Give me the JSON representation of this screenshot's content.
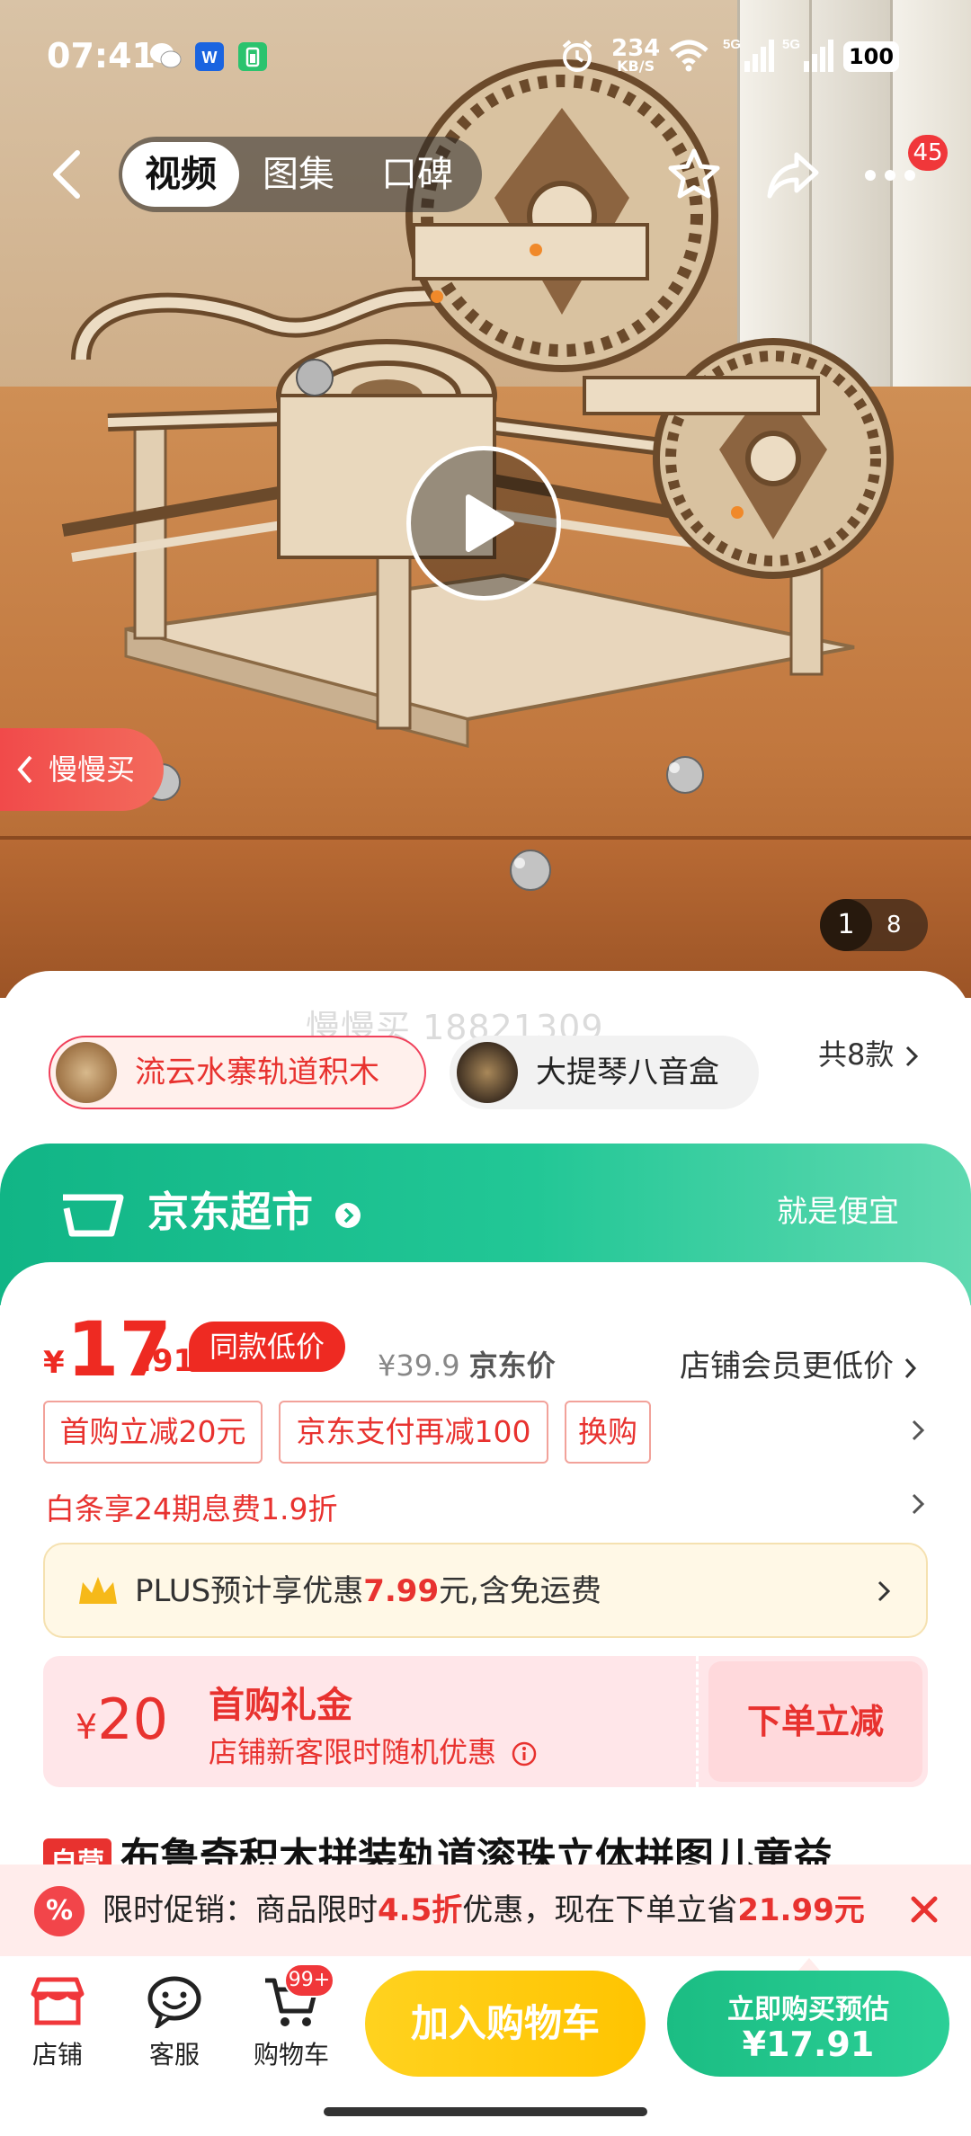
{
  "status_bar": {
    "time": "07:41",
    "net_speed_value": "234",
    "net_speed_unit": "KB/S",
    "signal1": "5G",
    "signal2": "5G",
    "battery": "100"
  },
  "nav": {
    "tabs": [
      {
        "label": "视频",
        "active": true
      },
      {
        "label": "图集",
        "active": false
      },
      {
        "label": "口碑",
        "active": false
      }
    ],
    "more_badge": "45",
    "icons": [
      "back-icon",
      "star-icon",
      "share-icon",
      "more-icon"
    ]
  },
  "gallery": {
    "slow_buy": "慢慢买",
    "page_current": "1",
    "page_total": "8",
    "play": "play-icon"
  },
  "watermark": "慢慢买 18821309",
  "variants": {
    "items": [
      {
        "label": "流云水寨轨道积木",
        "selected": true
      },
      {
        "label": "大提琴八音盒",
        "selected": false
      }
    ],
    "count": "共8款"
  },
  "jd_supermarket": {
    "logo": "京东超市",
    "slogan": "就是便宜"
  },
  "price": {
    "currency": "¥",
    "integer": "17",
    "decimal": ".91",
    "tag": "同款低价",
    "original": "¥39.9",
    "original_label": "京东价",
    "member": "店铺会员更低价"
  },
  "coupons": [
    "首购立减20元",
    "京东支付再减100",
    "换购"
  ],
  "baitiao": "白条享24期息费1.9折",
  "plus": {
    "prefix": "PLUS预计享优惠",
    "amount": "7.99",
    "suffix": "元,含免运费"
  },
  "gift": {
    "currency": "¥",
    "amount": "20",
    "title": "首购礼金",
    "desc": "店铺新客限时随机优惠",
    "action": "下单立减"
  },
  "product": {
    "badge": "自营",
    "title": "布鲁奇积木拼装轨道滚珠立体拼图儿童益"
  },
  "promo": {
    "icon_text": "%",
    "p1": "限时促销：商品限时",
    "discount": "4.5折",
    "p2": "优惠，现在下单立省",
    "save": "21.99元"
  },
  "bottom": {
    "shop": "店铺",
    "service": "客服",
    "cart": "购物车",
    "cart_badge": "99+",
    "add_cart": "加入购物车",
    "buy_line1": "立即购买预估",
    "buy_line2": "¥17.91"
  },
  "colors": {
    "jd_red": "#e8322f",
    "jd_green": "#1bbd83",
    "cart_yellow": "#ffc400"
  }
}
